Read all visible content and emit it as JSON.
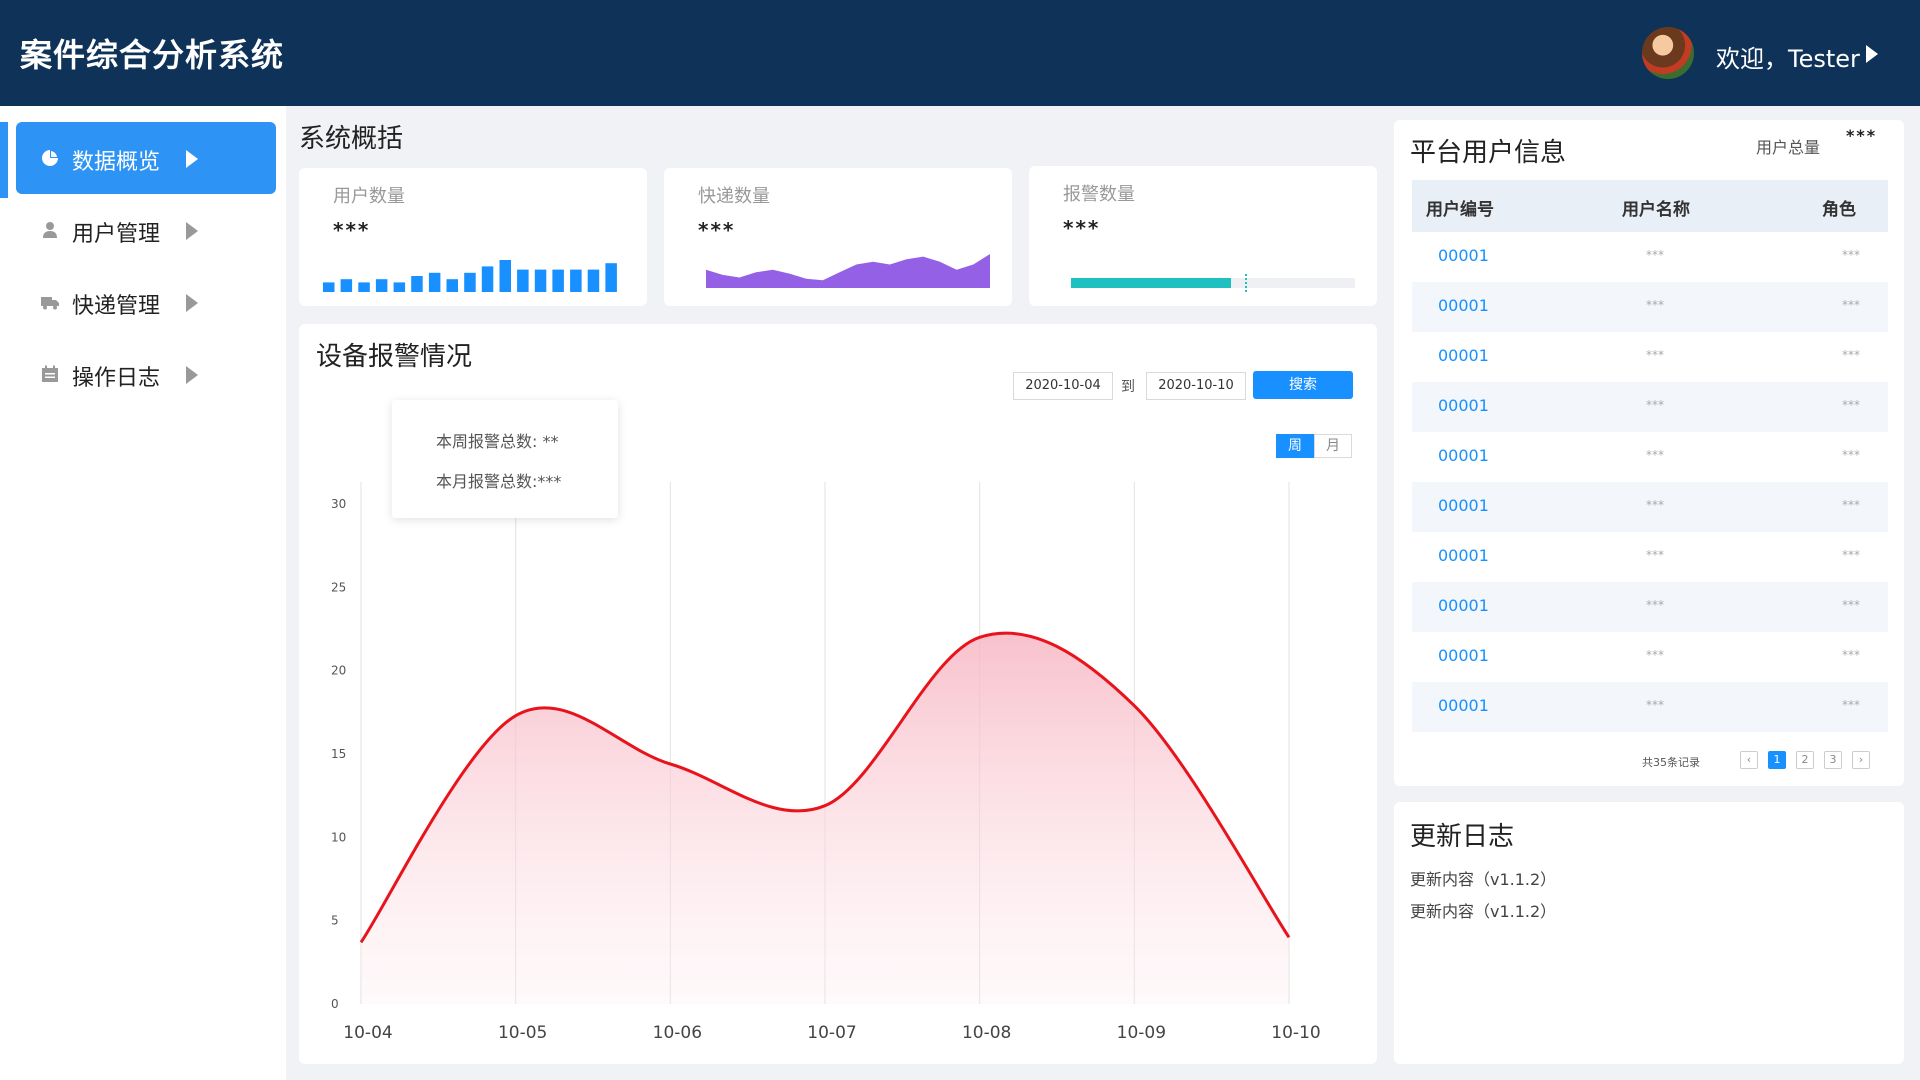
{
  "header": {
    "app_title": "案件综合分析系统",
    "welcome": "欢迎，Tester"
  },
  "sidebar": {
    "items": [
      {
        "label": "数据概览",
        "icon": "pie-chart-icon",
        "active": true
      },
      {
        "label": "用户管理",
        "icon": "user-icon",
        "active": false
      },
      {
        "label": "快递管理",
        "icon": "truck-icon",
        "active": false
      },
      {
        "label": "操作日志",
        "icon": "calendar-icon",
        "active": false
      }
    ]
  },
  "overview": {
    "title": "系统概括",
    "cards": [
      {
        "label": "用户数量",
        "value": "***",
        "chart": "mini-bar"
      },
      {
        "label": "快递数量",
        "value": "***",
        "chart": "mini-area"
      },
      {
        "label": "报警数量",
        "value": "***",
        "chart": "progress",
        "progress": 0.6
      }
    ],
    "mini_bar_values": [
      3,
      4,
      3,
      4,
      3,
      5,
      6,
      4,
      6,
      8,
      10,
      7,
      7,
      7,
      7,
      7,
      9
    ],
    "mini_area_values": [
      14,
      10,
      8,
      12,
      14,
      11,
      7,
      6,
      12,
      18,
      20,
      18,
      22,
      24,
      20,
      14,
      18,
      26
    ]
  },
  "alarm": {
    "title": "设备报警情况",
    "date_from": "2020-10-04",
    "to_label": "到",
    "date_to": "2020-10-10",
    "search_label": "搜索",
    "period_week": "周",
    "period_month": "月",
    "week_total": "本周报警总数: **",
    "month_total": "本月报警总数:***"
  },
  "chart_data": {
    "type": "area",
    "x": [
      "10-04",
      "10-05",
      "10-06",
      "10-07",
      "10-08",
      "10-09",
      "10-10"
    ],
    "series": [
      {
        "values": [
          3.7,
          17.3,
          14.4,
          11.9,
          22,
          17.9,
          4
        ]
      }
    ],
    "ylim": [
      0,
      30
    ],
    "yticks": [
      0,
      5,
      10,
      15,
      20,
      25,
      30
    ],
    "grid": "vertical",
    "line_color": "#e8141c",
    "fill_color": "#fbd3da"
  },
  "users": {
    "title": "平台用户信息",
    "total_label": "用户总量",
    "total_value": "***",
    "columns": [
      "用户编号",
      "用户名称",
      "角色"
    ],
    "rows": [
      {
        "id": "00001",
        "name": "***",
        "role": "***"
      },
      {
        "id": "00001",
        "name": "***",
        "role": "***"
      },
      {
        "id": "00001",
        "name": "***",
        "role": "***"
      },
      {
        "id": "00001",
        "name": "***",
        "role": "***"
      },
      {
        "id": "00001",
        "name": "***",
        "role": "***"
      },
      {
        "id": "00001",
        "name": "***",
        "role": "***"
      },
      {
        "id": "00001",
        "name": "***",
        "role": "***"
      },
      {
        "id": "00001",
        "name": "***",
        "role": "***"
      },
      {
        "id": "00001",
        "name": "***",
        "role": "***"
      },
      {
        "id": "00001",
        "name": "***",
        "role": "***"
      }
    ],
    "pager_total": "共35条记录",
    "pages": [
      "1",
      "2",
      "3"
    ],
    "current_page": "1"
  },
  "changelog": {
    "title": "更新日志",
    "items": [
      "更新内容（v1.1.2）",
      "更新内容（v1.1.2）"
    ]
  },
  "colors": {
    "header_bg": "#0f3358",
    "accent": "#1890ff",
    "active_nav": "#2d93f5",
    "mini_area": "#9461e6",
    "progress": "#1fc0c0"
  }
}
